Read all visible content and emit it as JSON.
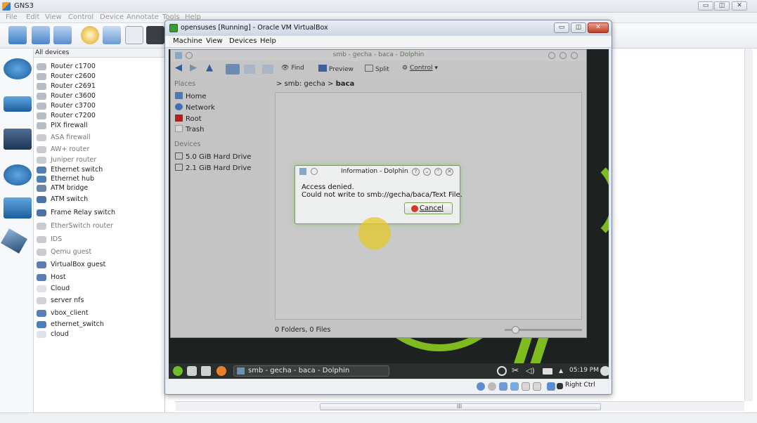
{
  "gns3": {
    "title": "GNS3",
    "menu": [
      "File",
      "Edit",
      "View",
      "Control",
      "Device",
      "Annotate",
      "Tools",
      "Help"
    ],
    "device_panel_header": "All devices",
    "devices": [
      {
        "label": "Router c1700",
        "dim": false
      },
      {
        "label": "Router c2600",
        "dim": false
      },
      {
        "label": "Router c2691",
        "dim": false
      },
      {
        "label": "Router c3600",
        "dim": false
      },
      {
        "label": "Router c3700",
        "dim": false
      },
      {
        "label": "Router c7200",
        "dim": false
      },
      {
        "label": "PIX firewall",
        "dim": false
      },
      {
        "label": "ASA firewall",
        "dim": true
      },
      {
        "label": "AW+ router",
        "dim": true
      },
      {
        "label": "Juniper router",
        "dim": true
      },
      {
        "label": "Ethernet switch",
        "dim": false
      },
      {
        "label": "Ethernet hub",
        "dim": false
      },
      {
        "label": "ATM bridge",
        "dim": false
      },
      {
        "label": "ATM switch",
        "dim": false
      },
      {
        "label": "Frame Relay switch",
        "dim": false
      },
      {
        "label": "EtherSwitch router",
        "dim": true
      },
      {
        "label": "IDS",
        "dim": true
      },
      {
        "label": "Qemu guest",
        "dim": true
      },
      {
        "label": "VirtualBox guest",
        "dim": false
      },
      {
        "label": "Host",
        "dim": false
      },
      {
        "label": "Cloud",
        "dim": false
      },
      {
        "label": "server nfs",
        "dim": false
      },
      {
        "label": "vbox_client",
        "dim": false
      },
      {
        "label": "ethernet_switch",
        "dim": false
      },
      {
        "label": "cloud",
        "dim": false
      }
    ],
    "hscroll_mark": "III"
  },
  "vbox": {
    "title": "opensuses [Running] - Oracle VM VirtualBox",
    "menu": [
      "Machine",
      "View",
      "Devices",
      "Help"
    ],
    "host_key": "Right Ctrl"
  },
  "dolphin": {
    "title": "smb - gecha - baca - Dolphin",
    "toolbar": {
      "find": "Find",
      "preview": "Preview",
      "split": "Split",
      "control": "Control"
    },
    "places_header": "Places",
    "places": [
      "Home",
      "Network",
      "Root",
      "Trash"
    ],
    "devices_header": "Devices",
    "devices": [
      "5.0 GiB Hard Drive",
      "2.1 GiB Hard Drive"
    ],
    "breadcrumb_prefix": "> smb: gecha >",
    "breadcrumb_current": "baca",
    "status": "0 Folders, 0 Files"
  },
  "dialog": {
    "title": "Information - Dolphin",
    "line1": "Access denied.",
    "line2": "Could not write to smb://gecha/baca/Text File.",
    "cancel_label": "Cancel"
  },
  "vm_taskbar": {
    "task_label": "smb - gecha - baca - Dolphin",
    "clock": "05:19 PM"
  },
  "colors": {
    "accent_green": "#7dbb1f",
    "close_red": "#c43d25",
    "cursor_highlight": "#e6c828"
  }
}
